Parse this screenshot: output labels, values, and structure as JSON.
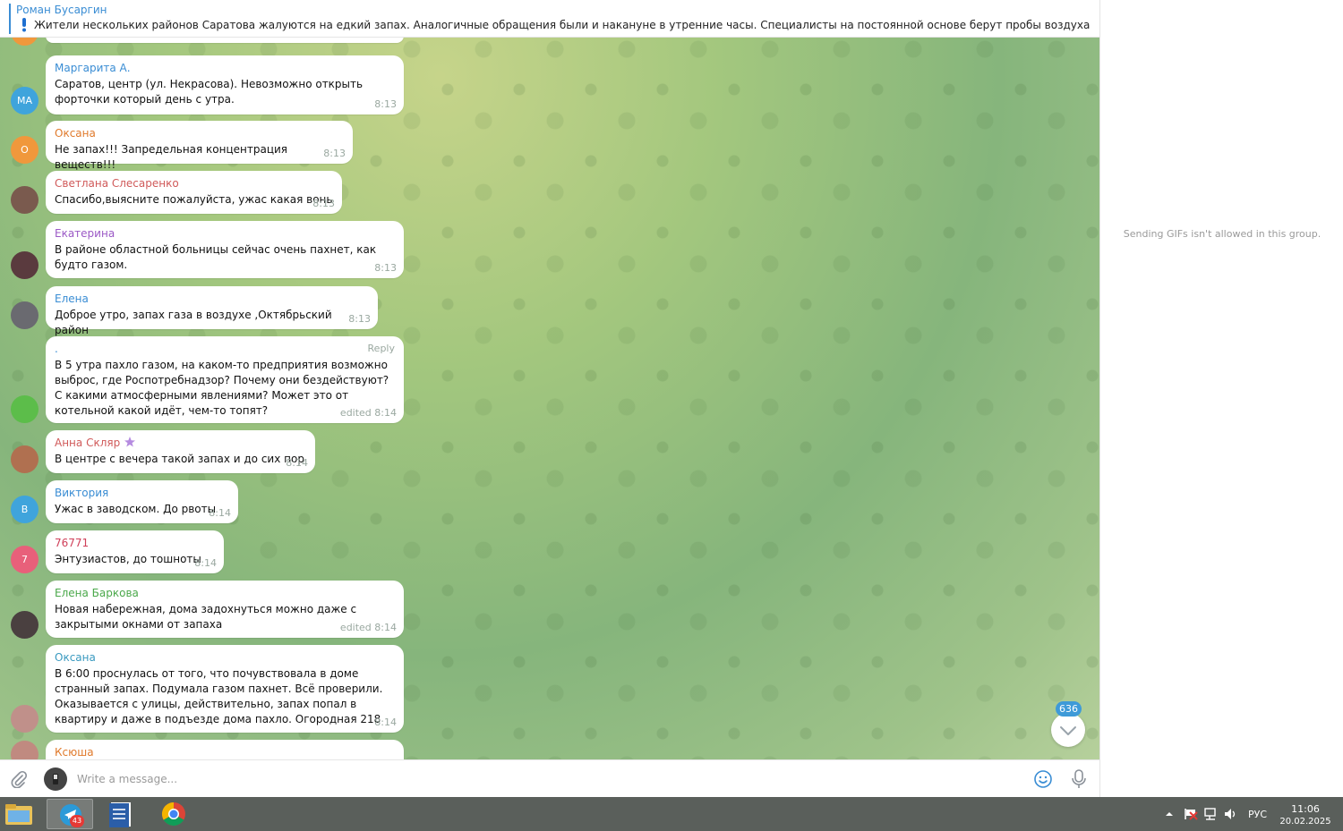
{
  "pinned": {
    "sender": "Роман Бусаргин",
    "text": "Жители нескольких районов Саратова жалуются на едкий запах. Аналогичные обращения были и накануне в утренние часы.   Специалисты на постоянной основе берут пробы воздуха и анализируют ..."
  },
  "colors": {
    "accent": "#3a8dd4",
    "chat_bg": "#9fc38a",
    "bubble": "#ffffff"
  },
  "messages": [
    {
      "avatar": "МА",
      "avatar_color": "#3fa4dc",
      "name": "Маргарита А.",
      "name_color": "#3a8dd4",
      "text": "Саратов, центр (ул. Некрасова). Невозможно открыть форточки который день с утра.",
      "time": "8:13"
    },
    {
      "avatar": "О",
      "avatar_color": "#f0983c",
      "name": "Оксана",
      "name_color": "#e07a2c",
      "text": "Не запах!!! Запредельная концентрация веществ!!!",
      "time": "8:13"
    },
    {
      "avatar": "",
      "avatar_color": "#7a5a4e",
      "name": "Светлана Слесаренко",
      "name_color": "#d05a5a",
      "text": "Спасибо,выясните пожалуйста, ужас какая вонь",
      "time": "8:13"
    },
    {
      "avatar": "",
      "avatar_color": "#5a3a3e",
      "name": "Екатерина",
      "name_color": "#9b59c6",
      "text": "В районе областной больницы сейчас очень пахнет, как будто газом.",
      "time": "8:13"
    },
    {
      "avatar": "",
      "avatar_color": "#6a6a70",
      "name": "Елена",
      "name_color": "#3a8dd4",
      "text": "Доброе утро, запах газа в воздухе ,Октябрьский район",
      "time": "8:13"
    },
    {
      "avatar": "",
      "avatar_color": "#5cbd4a",
      "name": ".",
      "name_color": "#3a8dd4",
      "reply": "Reply",
      "text": "В 5 утра пахло газом, на каком-то предприятия возможно выброс, где Роспотребнадзор? Почему они бездействуют? С какими атмосферными явлениями? Может это от котельной какой идёт, чем-то топят?",
      "time": "edited 8:14"
    },
    {
      "avatar": "",
      "avatar_color": "#b07050",
      "name": "Анна Скляр",
      "name_color": "#d05a5a",
      "text": "В центре с вечера такой запах и до сих пор",
      "time": "8:14"
    },
    {
      "avatar": "В",
      "avatar_color": "#3fa4dc",
      "name": "Виктория",
      "name_color": "#3a8dd4",
      "text": "Ужас в заводском. До рвоты",
      "time": "8:14"
    },
    {
      "avatar": "7",
      "avatar_color": "#e8607a",
      "name": "76771",
      "name_color": "#d0405a",
      "text": "Энтузиастов, до тошноты",
      "time": "8:14"
    },
    {
      "avatar": "",
      "avatar_color": "#4a4040",
      "name": "Елена Баркова",
      "name_color": "#4aa84a",
      "text": "Новая набережная, дома задохнуться можно даже с закрытыми окнами от запаха",
      "time": "edited 8:14"
    },
    {
      "avatar": "",
      "avatar_color": "#c0908a",
      "name": "Оксана",
      "name_color": "#3a9ac0",
      "text": "В 6:00 проснулась от того, что почувствовала в доме странный запах. Подумала газом пахнет. Всё проверили. Оказывается с улицы, действительно, запах попал в квартиру и даже в подъезде дома пахло. Огородная 218",
      "time": "8:14"
    },
    {
      "avatar": "",
      "avatar_color": "#c08a80",
      "name": "Ксюша",
      "name_color": "#e07a2c",
      "text": "",
      "time": ""
    }
  ],
  "unread_count": "636",
  "composer": {
    "placeholder": "Write a message..."
  },
  "right_panel": {
    "note": "Sending GIFs isn't allowed in this group."
  },
  "taskbar": {
    "telegram_badge": "43",
    "lang": "РУС",
    "time": "11:06",
    "date": "20.02.2025"
  }
}
